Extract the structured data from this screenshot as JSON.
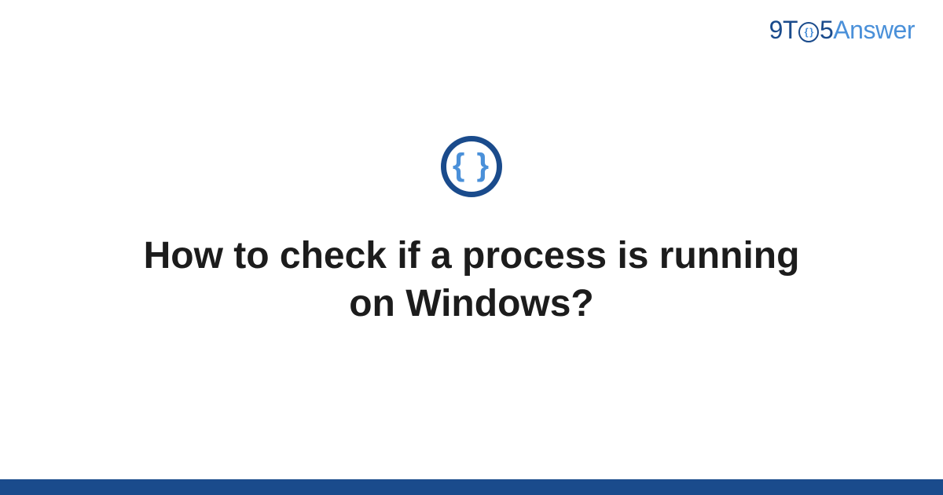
{
  "logo": {
    "part_9": "9",
    "part_t": "T",
    "part_o_inner": "{ }",
    "part_5": "5",
    "part_answer": "Answer"
  },
  "badge": {
    "icon_name": "code-braces-icon",
    "glyph": "{ }"
  },
  "main": {
    "title": "How to check if a process is running on Windows?"
  },
  "colors": {
    "primary_dark": "#1a4b8c",
    "primary_light": "#4a90d9",
    "text": "#1c1c1c",
    "background": "#ffffff"
  }
}
